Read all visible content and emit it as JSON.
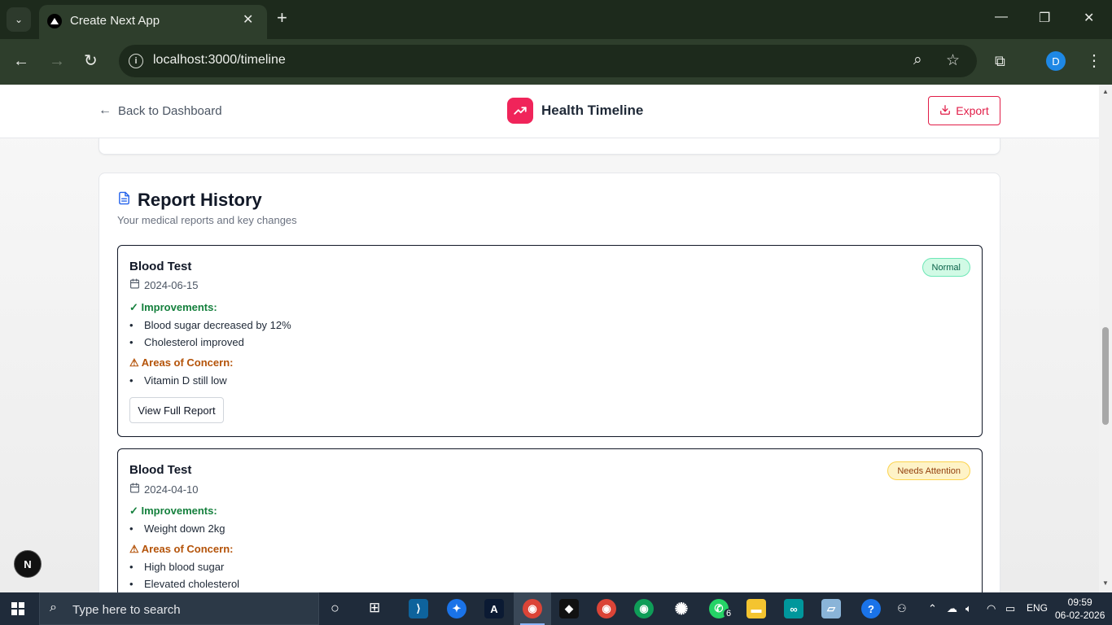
{
  "browser": {
    "tab_title": "Create Next App",
    "url": "localhost:3000/timeline",
    "profile_initial": "D"
  },
  "header": {
    "back_label": "Back to Dashboard",
    "title": "Health Timeline",
    "export_label": "Export"
  },
  "history": {
    "title": "Report History",
    "subtitle": "Your medical reports and key changes",
    "reports": [
      {
        "title": "Blood Test",
        "date": "2024-06-15",
        "status": "Normal",
        "improvements_label": "✓ Improvements:",
        "improvements": [
          "Blood sugar decreased by 12%",
          "Cholesterol improved"
        ],
        "concerns_label": "⚠ Areas of Concern:",
        "concerns": [
          "Vitamin D still low"
        ],
        "view_label": "View Full Report"
      },
      {
        "title": "Blood Test",
        "date": "2024-04-10",
        "status": "Needs Attention",
        "improvements_label": "✓ Improvements:",
        "improvements": [
          "Weight down 2kg"
        ],
        "concerns_label": "⚠ Areas of Concern:",
        "concerns": [
          "High blood sugar",
          "Elevated cholesterol"
        ]
      }
    ]
  },
  "next_badge": "N",
  "taskbar": {
    "search_placeholder": "Type here to search",
    "whatsapp_count": "6",
    "language": "ENG",
    "time": "09:59",
    "date": "06-02-2026"
  },
  "colors": {
    "accent": "#f0245a",
    "export": "#e11d48",
    "improvement": "#15803d",
    "concern": "#b45309"
  }
}
